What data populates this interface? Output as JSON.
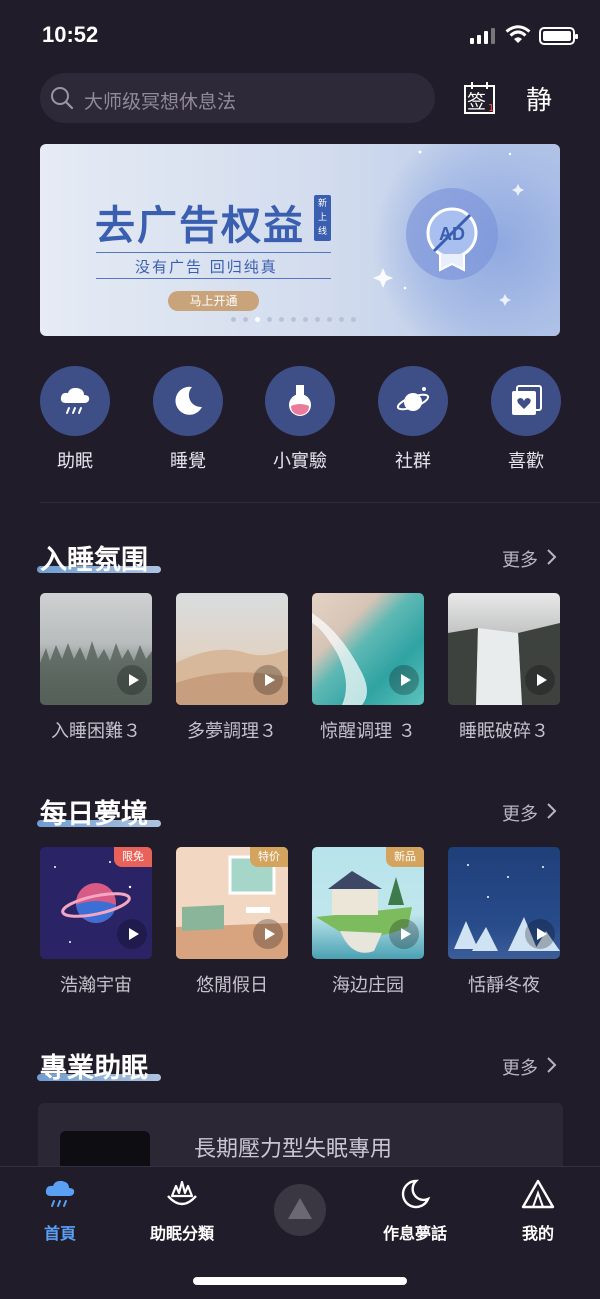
{
  "status_bar": {
    "time": "10:52"
  },
  "search": {
    "placeholder": "大师级冥想休息法"
  },
  "header": {
    "sign_label": "签",
    "sign_badge": "1",
    "quiet_label": "静"
  },
  "banner": {
    "title": "去广告权益",
    "tag": "新上线",
    "subtitle": "没有广告  回归纯真",
    "button": "马上开通",
    "badge_text": "AD",
    "dot_count": 11,
    "active_dot": 2
  },
  "categories": [
    {
      "label": "助眠",
      "icon": "rain-cloud-icon"
    },
    {
      "label": "睡覺",
      "icon": "moon-icon"
    },
    {
      "label": "小實驗",
      "icon": "flask-icon"
    },
    {
      "label": "社群",
      "icon": "planet-icon"
    },
    {
      "label": "喜歡",
      "icon": "heart-photo-icon"
    }
  ],
  "sections": {
    "sleep": {
      "title": "入睡氛围",
      "more": "更多",
      "items": [
        {
          "label": "入睡困難３"
        },
        {
          "label": "多夢調理３"
        },
        {
          "label": "惊醒调理 ３"
        },
        {
          "label": "睡眠破碎３"
        }
      ]
    },
    "dream": {
      "title": "每日夢境",
      "more": "更多",
      "items": [
        {
          "label": "浩瀚宇宙",
          "tag": "限免",
          "tag_color": "#e8625a"
        },
        {
          "label": "悠閒假日",
          "tag": "特价",
          "tag_color": "#d4a45f"
        },
        {
          "label": "海边庄园",
          "tag": "新品",
          "tag_color": "#d4a45f"
        },
        {
          "label": "恬靜冬夜",
          "tag": ""
        }
      ]
    },
    "pro": {
      "title": "專業助眠",
      "more": "更多",
      "card_title": "長期壓力型失眠專用"
    }
  },
  "tabbar": {
    "items": [
      {
        "label": "首頁",
        "active": true
      },
      {
        "label": "助眠分類",
        "active": false
      },
      {
        "label": "作息夢話",
        "active": false
      },
      {
        "label": "我的",
        "active": false
      }
    ]
  },
  "colors": {
    "accent": "#5aa0f5",
    "background": "#211c2a",
    "category_circle": "#3e4e86"
  }
}
